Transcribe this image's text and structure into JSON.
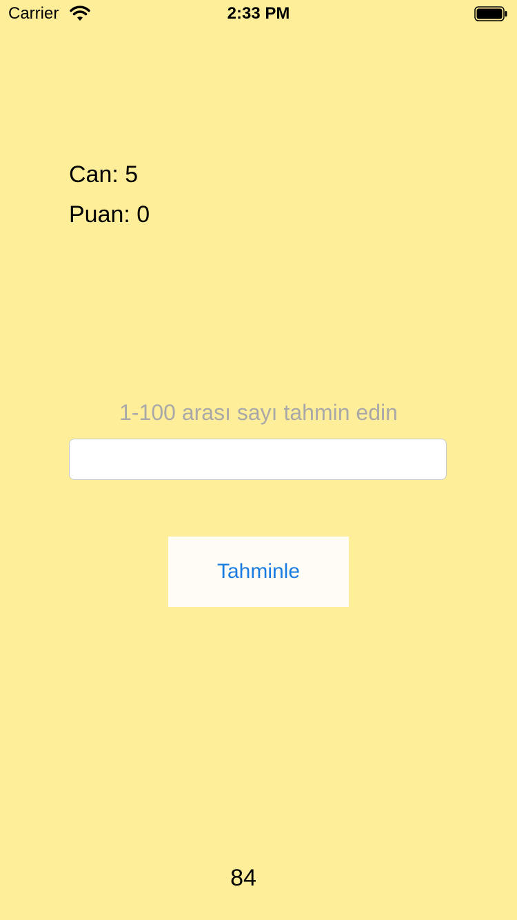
{
  "status_bar": {
    "carrier": "Carrier",
    "time": "2:33 PM",
    "wifi_icon": "wifi-icon",
    "battery_icon": "battery-full-icon"
  },
  "game": {
    "lives": "Can: 5",
    "score": "Puan: 0",
    "hint": "1-100 arası sayı tahmin edin",
    "guess_value": "",
    "guess_placeholder": "",
    "button_label": "Tahminle",
    "bottom_number": "84"
  },
  "colors": {
    "background": "#FFEE99",
    "button_text": "#1A7BE0",
    "hint_text": "#A8A8A8"
  }
}
